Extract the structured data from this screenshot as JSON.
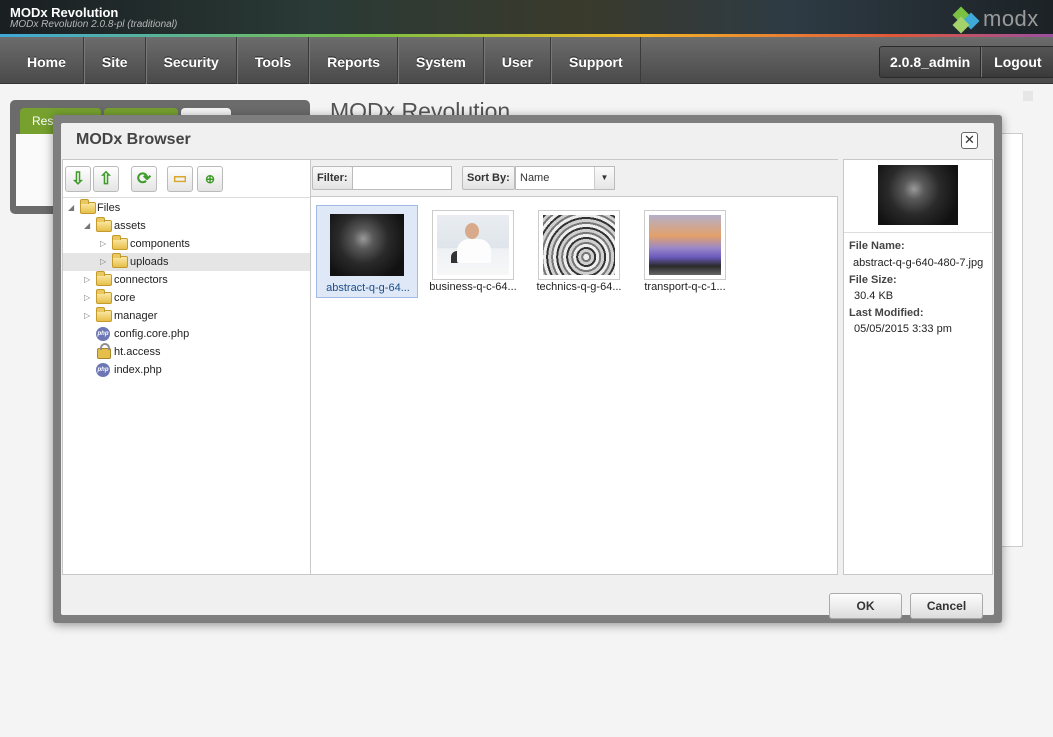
{
  "header": {
    "title": "MODx Revolution",
    "subtitle": "MODx Revolution 2.0.8-pl (traditional)",
    "logo_text": "modx"
  },
  "nav": {
    "items": [
      "Home",
      "Site",
      "Security",
      "Tools",
      "Reports",
      "System",
      "User",
      "Support"
    ],
    "username": "2.0.8_admin",
    "logout": "Logout"
  },
  "background": {
    "tabs": [
      "Resources",
      "Elements",
      "Files"
    ],
    "page_title": "MODx Revolution"
  },
  "browser": {
    "title": "MODx Browser",
    "close_glyph": "✕",
    "toolbar_icons": [
      "arrow-down-icon",
      "arrow-up-icon",
      "refresh-icon",
      "folder-icon",
      "upload-file-icon"
    ],
    "tree": [
      {
        "label": "Files",
        "type": "folder",
        "expanded": true
      },
      {
        "label": "assets",
        "type": "folder",
        "expanded": true
      },
      {
        "label": "components",
        "type": "folder",
        "expanded": false
      },
      {
        "label": "uploads",
        "type": "folder",
        "expanded": false,
        "selected": true
      },
      {
        "label": "connectors",
        "type": "folder",
        "expanded": false
      },
      {
        "label": "core",
        "type": "folder",
        "expanded": false
      },
      {
        "label": "manager",
        "type": "folder",
        "expanded": false
      },
      {
        "label": "config.core.php",
        "type": "php"
      },
      {
        "label": "ht.access",
        "type": "lock"
      },
      {
        "label": "index.php",
        "type": "php"
      }
    ],
    "filter_label": "Filter:",
    "filter_value": "",
    "sort_label": "Sort By:",
    "sort_value": "Name",
    "files": [
      {
        "label": "abstract-q-g-64...",
        "selected": true
      },
      {
        "label": "business-q-c-64..."
      },
      {
        "label": "technics-q-g-64..."
      },
      {
        "label": "transport-q-c-1..."
      }
    ],
    "details": {
      "file_name_label": "File Name:",
      "file_name": "abstract-q-g-640-480-7.jpg",
      "file_size_label": "File Size:",
      "file_size": "30.4 KB",
      "last_modified_label": "Last Modified:",
      "last_modified": "05/05/2015 3:33 pm"
    },
    "ok": "OK",
    "cancel": "Cancel"
  }
}
